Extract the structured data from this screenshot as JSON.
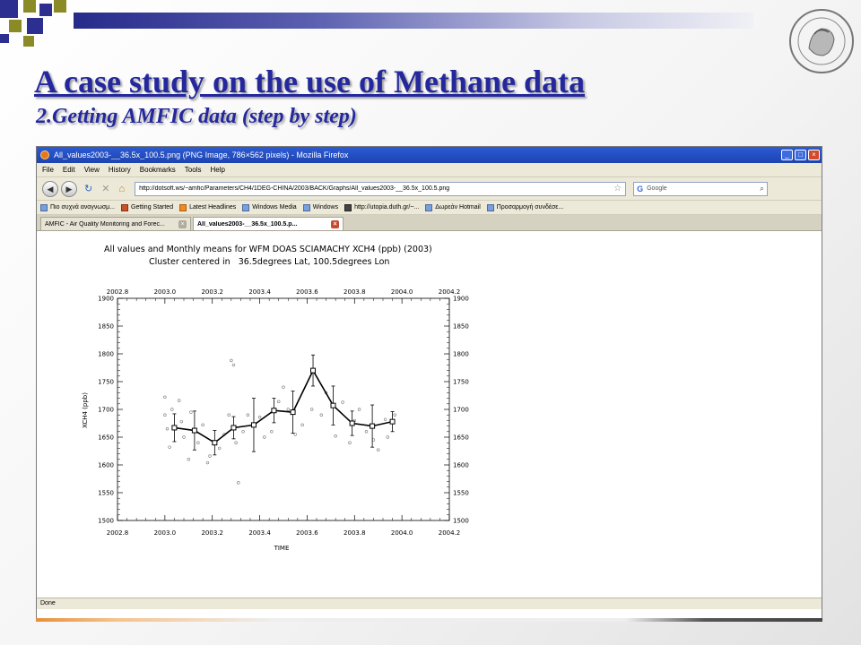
{
  "slide": {
    "title": "A case study on the use of Methane data",
    "subtitle": "2.Getting AMFIC data (step by step)",
    "colors": {
      "title": "#24289c",
      "topbar": "#262a8a",
      "square_blue": "#2c2f8f",
      "square_olive": "#8a8a26"
    },
    "seal_icon": "university-seal-icon"
  },
  "browser": {
    "window_title": "All_values2003-__36.5x_100.5.png (PNG Image, 786×562 pixels) - Mozilla Firefox",
    "window_buttons": [
      "_",
      "□",
      "×"
    ],
    "menu": [
      "File",
      "Edit",
      "View",
      "History",
      "Bookmarks",
      "Tools",
      "Help"
    ],
    "nav_icons": [
      "back-icon",
      "forward-icon",
      "reload-icon",
      "stop-icon",
      "home-icon"
    ],
    "url": "http://dotsoft.ws/~amfic/Parameters/CH4/1DEG-CHINA/2003/BACK/Graphs/All_values2003-__36.5x_100.5.png",
    "search_placeholder": "Google",
    "bookmarks": [
      "Πιο συχνά αναγνωσμ...",
      "Getting Started",
      "Latest Headlines",
      "Windows Media",
      "Windows",
      "http://utopia.duth.gr/~...",
      "Δωρεάν Hotmail",
      "Προσαρμογή συνδέσε..."
    ],
    "tabs": [
      {
        "label": "AMFIC - Air Quality Monitoring and Forec...",
        "active": false
      },
      {
        "label": "All_values2003-__36.5x_100.5.p...",
        "active": true
      }
    ],
    "status": "Done"
  },
  "chart_data": {
    "type": "scatter",
    "title": "All values and Monthly means for WFM DOAS SCIAMACHY XCH4 (ppb) (2003)",
    "subtitle": "Cluster centered in   36.5degrees Lat, 100.5degrees Lon",
    "xlabel": "TIME",
    "ylabel": "XCH4 (ppb)",
    "xlim": [
      2002.8,
      2004.2
    ],
    "ylim": [
      1500,
      1900
    ],
    "x_ticks": [
      "2002.8",
      "2003.0",
      "2003.2",
      "2003.4",
      "2003.6",
      "2003.8",
      "2004.0",
      "2004.2"
    ],
    "y_ticks": [
      "1500",
      "1550",
      "1600",
      "1650",
      "1700",
      "1750",
      "1800",
      "1850",
      "1900"
    ],
    "grid": false,
    "series": [
      {
        "kind": "monthly_mean_line",
        "x": [
          2003.04,
          2003.125,
          2003.21,
          2003.29,
          2003.375,
          2003.46,
          2003.54,
          2003.625,
          2003.71,
          2003.79,
          2003.875,
          2003.96
        ],
        "y": [
          1667,
          1662,
          1640,
          1667,
          1672,
          1698,
          1695,
          1770,
          1707,
          1675,
          1670,
          1678
        ],
        "err": [
          25,
          35,
          22,
          20,
          48,
          22,
          38,
          28,
          35,
          22,
          38,
          18
        ]
      },
      {
        "kind": "all_values",
        "points": [
          [
            2003.0,
            1722
          ],
          [
            2003.0,
            1690
          ],
          [
            2003.01,
            1665
          ],
          [
            2003.02,
            1632
          ],
          [
            2003.03,
            1700
          ],
          [
            2003.06,
            1716
          ],
          [
            2003.07,
            1678
          ],
          [
            2003.08,
            1650
          ],
          [
            2003.1,
            1610
          ],
          [
            2003.11,
            1695
          ],
          [
            2003.14,
            1640
          ],
          [
            2003.16,
            1672
          ],
          [
            2003.18,
            1604
          ],
          [
            2003.19,
            1616
          ],
          [
            2003.23,
            1630
          ],
          [
            2003.25,
            1655
          ],
          [
            2003.27,
            1690
          ],
          [
            2003.28,
            1788
          ],
          [
            2003.29,
            1780
          ],
          [
            2003.3,
            1640
          ],
          [
            2003.31,
            1568
          ],
          [
            2003.33,
            1660
          ],
          [
            2003.35,
            1690
          ],
          [
            2003.4,
            1686
          ],
          [
            2003.42,
            1650
          ],
          [
            2003.45,
            1660
          ],
          [
            2003.48,
            1714
          ],
          [
            2003.5,
            1740
          ],
          [
            2003.52,
            1700
          ],
          [
            2003.55,
            1655
          ],
          [
            2003.58,
            1672
          ],
          [
            2003.62,
            1700
          ],
          [
            2003.66,
            1690
          ],
          [
            2003.68,
            1730
          ],
          [
            2003.72,
            1652
          ],
          [
            2003.75,
            1713
          ],
          [
            2003.78,
            1640
          ],
          [
            2003.8,
            1680
          ],
          [
            2003.82,
            1700
          ],
          [
            2003.85,
            1660
          ],
          [
            2003.88,
            1645
          ],
          [
            2003.9,
            1627
          ],
          [
            2003.93,
            1682
          ],
          [
            2003.94,
            1650
          ],
          [
            2003.97,
            1690
          ]
        ]
      }
    ]
  }
}
